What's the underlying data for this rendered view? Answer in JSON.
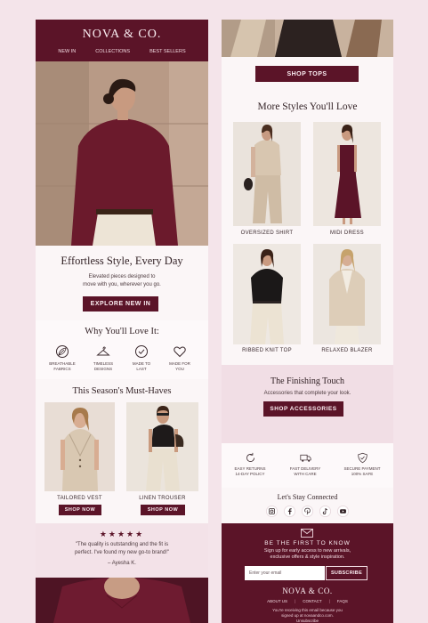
{
  "brand": "NOVA & CO.",
  "nav": [
    "NEW IN",
    "COLLECTIONS",
    "BEST SELLERS"
  ],
  "hero": {
    "title": "Effortless Style, Every Day",
    "subtitle_line1": "Elevated pieces designed to",
    "subtitle_line2": "move with you, wherever you go.",
    "cta": "EXPLORE NEW IN"
  },
  "why": {
    "title": "Why You'll Love It:",
    "items": [
      {
        "icon": "leaf-icon",
        "line1": "BREATHABLE",
        "line2": "FABRICS"
      },
      {
        "icon": "hanger-icon",
        "line1": "TIMELESS",
        "line2": "DESIGNS"
      },
      {
        "icon": "check-circle-icon",
        "line1": "MADE TO",
        "line2": "LAST"
      },
      {
        "icon": "heart-icon",
        "line1": "MADE FOR",
        "line2": "YOU"
      }
    ]
  },
  "must_haves": {
    "title": "This Season's Must-Haves",
    "products": [
      {
        "name": "TAILORED VEST",
        "cta": "SHOP NOW"
      },
      {
        "name": "LINEN TROUSER",
        "cta": "SHOP NOW"
      }
    ]
  },
  "review": {
    "stars": "★★★★★",
    "quote_line1": "\"The quality is outstanding and the fit is",
    "quote_line2": "perfect. I've found my new go-to brand!\"",
    "author": "– Ayesha K."
  },
  "right": {
    "shop_tops": "SHOP TOPS",
    "more_title": "More Styles You'll Love",
    "grid": [
      {
        "name": "OVERSIZED SHIRT"
      },
      {
        "name": "MIDI DRESS"
      },
      {
        "name": "RIBBED KNIT TOP"
      },
      {
        "name": "RELAXED BLAZER"
      }
    ],
    "finishing": {
      "title": "The Finishing Touch",
      "subtitle": "Accessories that complete your look.",
      "cta": "SHOP ACCESSORIES"
    },
    "features": [
      {
        "icon": "returns-icon",
        "line1": "EASY RETURNS",
        "line2": "14-DAY POLICY"
      },
      {
        "icon": "truck-icon",
        "line1": "FAST DELIVERY",
        "line2": "WITH CARE"
      },
      {
        "icon": "shield-icon",
        "line1": "SECURE PAYMENT",
        "line2": "100% SAFE"
      }
    ],
    "connected": "Let's Stay Connected",
    "social": [
      "instagram-icon",
      "facebook-icon",
      "pinterest-icon",
      "tiktok-icon",
      "youtube-icon"
    ],
    "newsletter": {
      "title": "BE THE FIRST TO KNOW",
      "line1": "Sign up for early access to new arrivals,",
      "line2": "exclusive offers & style inspiration.",
      "placeholder": "Enter your email",
      "cta": "SUBSCRIBE"
    },
    "footer": {
      "brand": "NOVA & CO.",
      "links": [
        "ABOUT US",
        "CONTACT",
        "FAQS"
      ],
      "line1": "You're receiving this email because you",
      "line2": "signed up at novaandco.com.",
      "unsubscribe": "Unsubscribe"
    }
  },
  "colors": {
    "maroon": "#5b1428",
    "blush": "#f4e4ea",
    "cream": "#fbf6f7"
  }
}
